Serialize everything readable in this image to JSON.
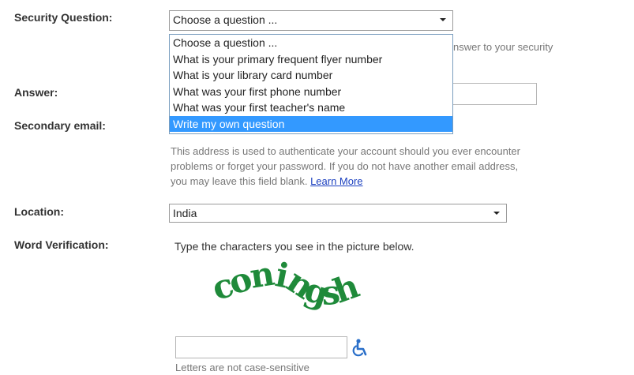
{
  "form": {
    "security_question": {
      "label": "Security Question:",
      "selected": "Choose a question ...",
      "options": [
        "Choose a question ...",
        "What is your primary frequent flyer number",
        "What is your library card number",
        "What was your first phone number",
        "What was your first teacher's name",
        "Write my own question"
      ],
      "highlighted_option": "Write my own question",
      "partial_help": "nswer to your security"
    },
    "answer": {
      "label": "Answer:",
      "value": ""
    },
    "secondary_email": {
      "label": "Secondary email:",
      "help_line1": "This address is used to authenticate your account should you ever encounter",
      "help_line2": "problems or forget your password. If you do not have another email address,",
      "help_line3": "you may leave this field blank.",
      "learn_more": "Learn More"
    },
    "location": {
      "label": "Location:",
      "selected": "India"
    },
    "word_verification": {
      "label": "Word Verification:",
      "instruction": "Type the characters you see in the picture below.",
      "captcha_text": "coningsh",
      "input_value": "",
      "note": "Letters are not case-sensitive",
      "accessibility_icon": "wheelchair-icon"
    }
  },
  "colors": {
    "highlight": "#3399ff",
    "link": "#1a3fbf",
    "captcha": "#1f8a3a",
    "accessibility": "#2a6fc9"
  }
}
